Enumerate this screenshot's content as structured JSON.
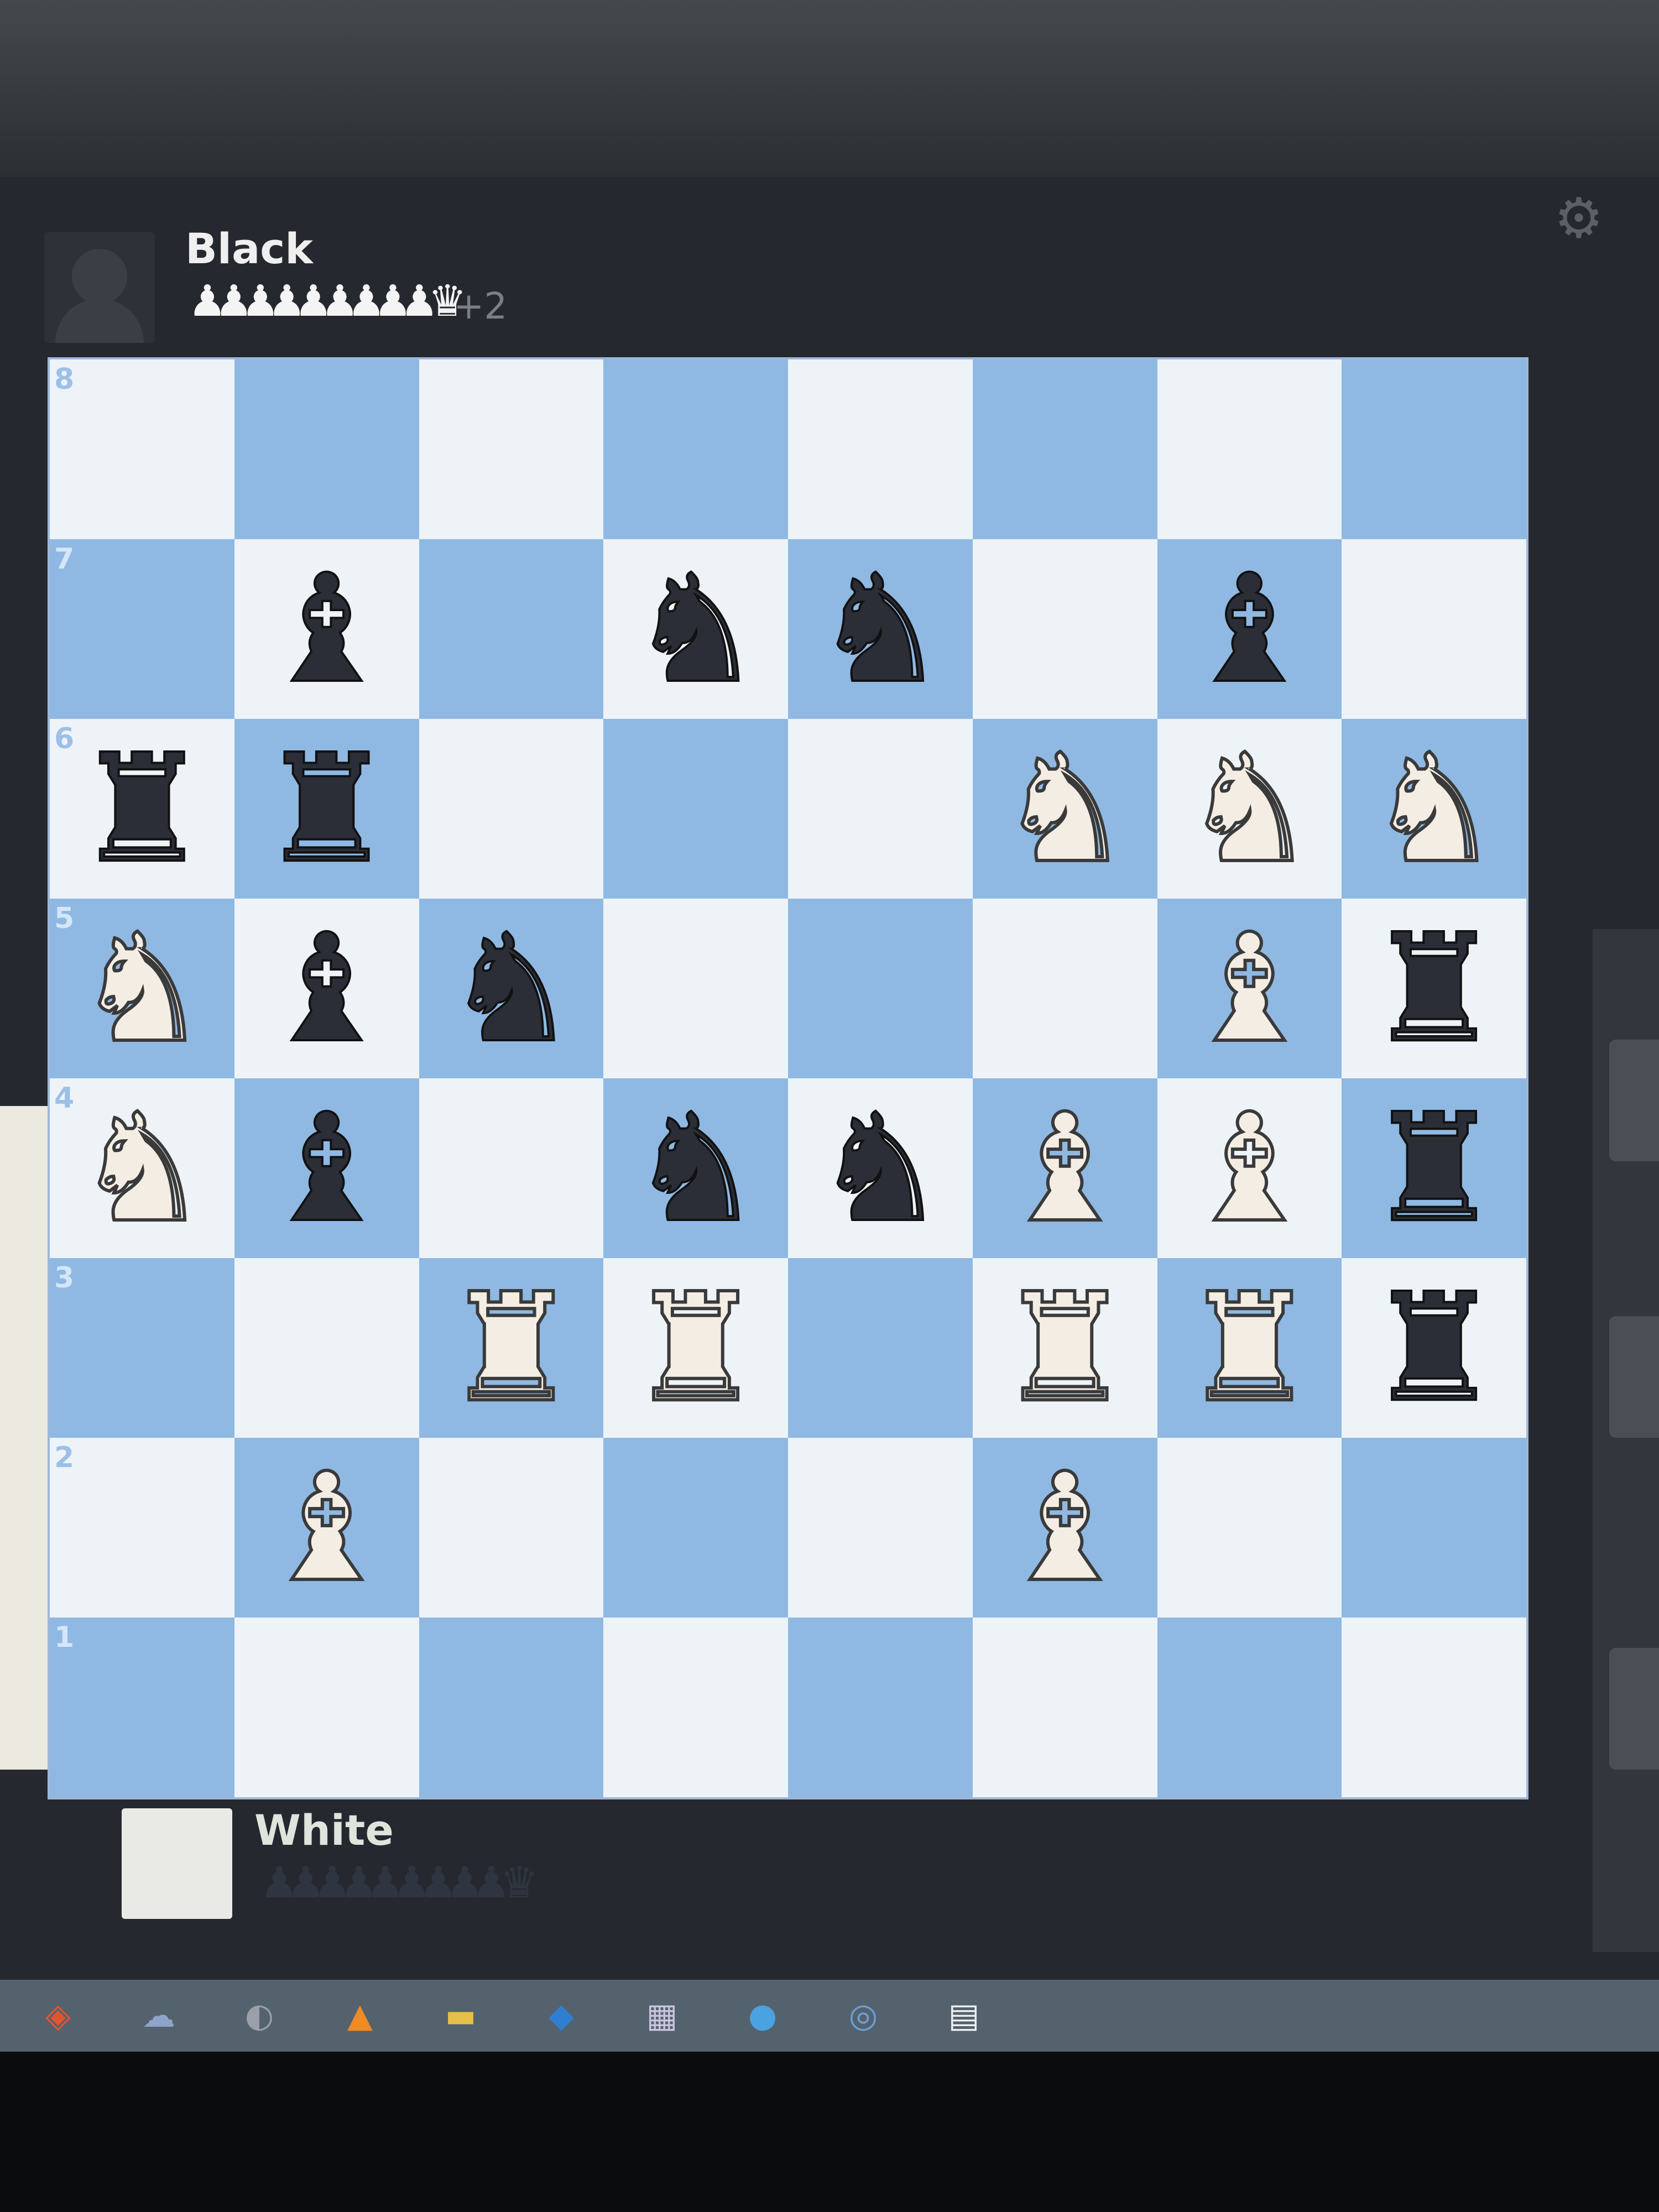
{
  "black_player": {
    "name": "Black",
    "captured": "♟♟♟♟♟♟♟♟♟ ♛",
    "advantage": "+2"
  },
  "white_player": {
    "name": "White",
    "captured": "♟♟♟♟♟♟♟♟♟ ♛"
  },
  "settings_icon": "gear-icon",
  "colors": {
    "light_square": "#eef3f8",
    "dark_square": "#8fb9e3"
  },
  "board": {
    "ranks": [
      "8",
      "7",
      "6",
      "5",
      "4",
      "3",
      "2",
      "1"
    ],
    "rows": [
      [
        "",
        "",
        "",
        "",
        "",
        "",
        "",
        ""
      ],
      [
        "",
        "bB",
        "",
        "bN",
        "bN",
        "",
        "bB",
        ""
      ],
      [
        "bR",
        "bR",
        "",
        "",
        "",
        "wN",
        "wN",
        "wN"
      ],
      [
        "wN",
        "bB",
        "bN",
        "",
        "",
        "",
        "wB",
        "bR"
      ],
      [
        "wN",
        "bB",
        "",
        "bN",
        "bN",
        "wB",
        "wB",
        "bR"
      ],
      [
        "",
        "",
        "wR",
        "wR",
        "",
        "wR",
        "wR",
        "bR"
      ],
      [
        "",
        "wB",
        "",
        "",
        "",
        "wB",
        "",
        ""
      ],
      [
        "",
        "",
        "",
        "",
        "",
        "",
        "",
        ""
      ]
    ]
  },
  "taskbar_icons": [
    "brave-icon",
    "cloud-icon",
    "app-icon",
    "vlc-icon",
    "folder-icon",
    "vscode-icon",
    "store-icon",
    "telegram-icon",
    "chrome-icon",
    "notepad-icon"
  ]
}
